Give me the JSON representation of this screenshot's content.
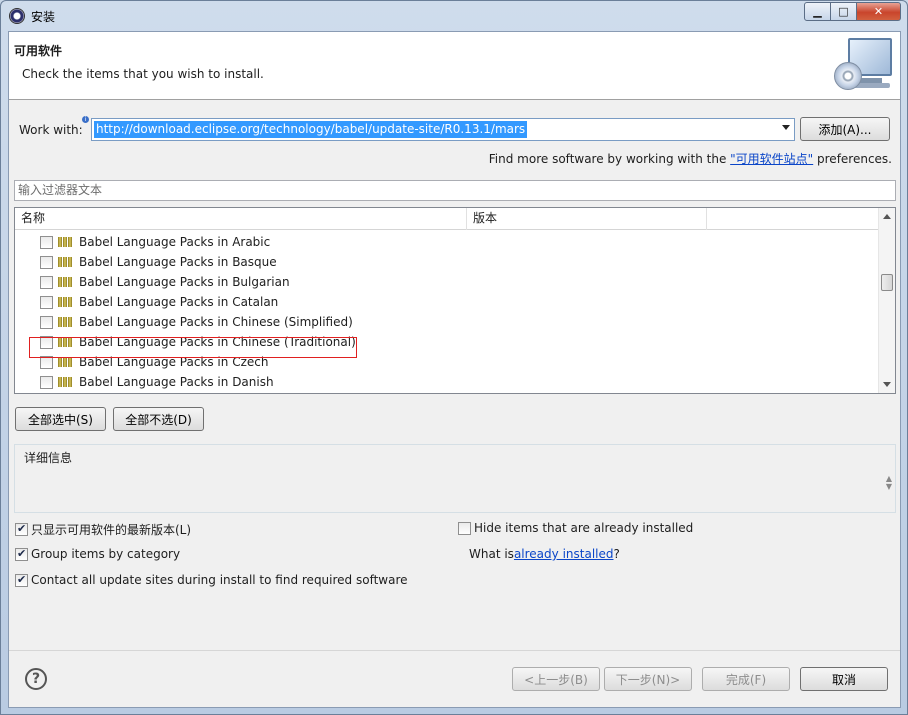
{
  "window": {
    "title": "安装"
  },
  "header": {
    "title": "可用软件",
    "description": "Check the items that you wish to install."
  },
  "work_with": {
    "label": "Work with:",
    "value": "http://download.eclipse.org/technology/babel/update-site/R0.13.1/mars",
    "add_button": "添加(A)..."
  },
  "find_more": {
    "prefix": "Find more software by working with the ",
    "link": "\"可用软件站点\"",
    "suffix": " preferences."
  },
  "filter": {
    "placeholder": "输入过滤器文本"
  },
  "tree": {
    "columns": [
      "名称",
      "版本"
    ],
    "rows": [
      {
        "label": "Babel Language Packs in Arabic",
        "checked": false
      },
      {
        "label": "Babel Language Packs in Basque",
        "checked": false
      },
      {
        "label": "Babel Language Packs in Bulgarian",
        "checked": false
      },
      {
        "label": "Babel Language Packs in Catalan",
        "checked": false
      },
      {
        "label": "Babel Language Packs in Chinese (Simplified)",
        "checked": false,
        "highlighted": true
      },
      {
        "label": "Babel Language Packs in Chinese (Traditional)",
        "checked": false
      },
      {
        "label": "Babel Language Packs in Czech",
        "checked": false
      },
      {
        "label": "Babel Language Packs in Danish",
        "checked": false
      }
    ]
  },
  "selection_buttons": {
    "select_all": "全部选中(S)",
    "deselect_all": "全部不选(D)"
  },
  "details": {
    "legend": "详细信息"
  },
  "options": {
    "latest_only": {
      "label": "只显示可用软件的最新版本(L)",
      "checked": true
    },
    "group_by_category": {
      "label": "Group items by category",
      "checked": true
    },
    "contact_sites": {
      "label": "Contact all update sites during install to find required software",
      "checked": true
    },
    "hide_installed": {
      "label": "Hide items that are already installed",
      "checked": false
    },
    "what_is": {
      "prefix": "What is ",
      "link": "already installed",
      "suffix": "?"
    }
  },
  "footer": {
    "help": "?",
    "back": "<上一步(B)",
    "next": "下一步(N)>",
    "finish": "完成(F)",
    "cancel": "取消"
  },
  "colors": {
    "selection": "#3399ff",
    "highlight_box": "#e02020",
    "link": "#0a45c8"
  }
}
